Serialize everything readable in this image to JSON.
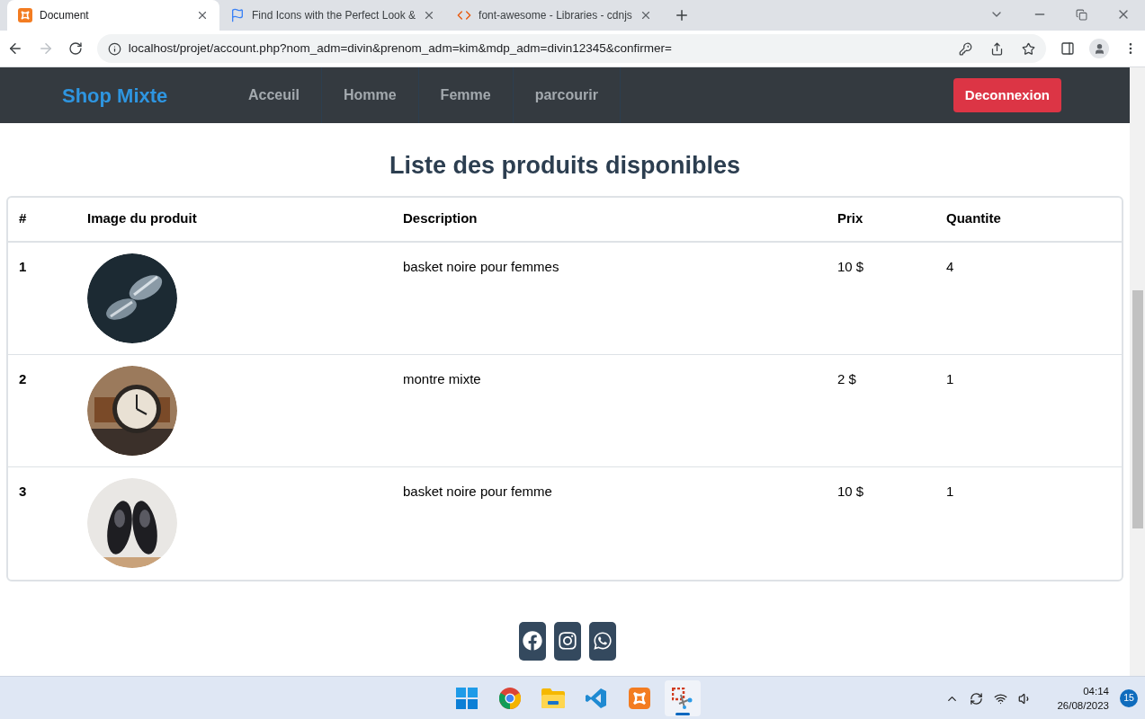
{
  "browser": {
    "tabs": [
      {
        "kind": "xampp",
        "title": "Document",
        "selected": true
      },
      {
        "kind": "flag",
        "title": "Find Icons with the Perfect Look &",
        "selected": false
      },
      {
        "kind": "code",
        "title": "font-awesome - Libraries - cdnjs",
        "selected": false
      }
    ],
    "url": "localhost/projet/account.php?nom_adm=divin&prenom_adm=kim&mdp_adm=divin12345&confirmer="
  },
  "navbar": {
    "brand": "Shop Mixte",
    "links": [
      {
        "label": "Acceuil"
      },
      {
        "label": "Homme"
      },
      {
        "label": "Femme"
      },
      {
        "label": "parcourir"
      }
    ],
    "logout_button": "Deconnexion"
  },
  "page": {
    "heading": "Liste des produits disponibles",
    "table": {
      "columns": [
        "#",
        "Image du produit",
        "Description",
        "Prix",
        "Quantite"
      ],
      "rows": [
        {
          "number": "1",
          "description": "basket noire pour femmes",
          "price": "10 $",
          "quantity": "4"
        },
        {
          "number": "2",
          "description": "montre mixte",
          "price": "2 $",
          "quantity": "1"
        },
        {
          "number": "3",
          "description": "basket noire pour femme",
          "price": "10 $",
          "quantity": "1"
        }
      ]
    },
    "social": [
      {
        "kind": "facebook"
      },
      {
        "kind": "instagram"
      },
      {
        "kind": "whatsapp"
      }
    ]
  },
  "taskbar": {
    "apps": [
      {
        "kind": "start",
        "selected": false
      },
      {
        "kind": "chrome",
        "selected": false
      },
      {
        "kind": "explorer",
        "selected": false
      },
      {
        "kind": "vscode",
        "selected": false
      },
      {
        "kind": "xampp",
        "selected": false
      },
      {
        "kind": "snip",
        "selected": true
      }
    ],
    "time": "04:14",
    "date": "26/08/2023",
    "notifications": "15"
  }
}
